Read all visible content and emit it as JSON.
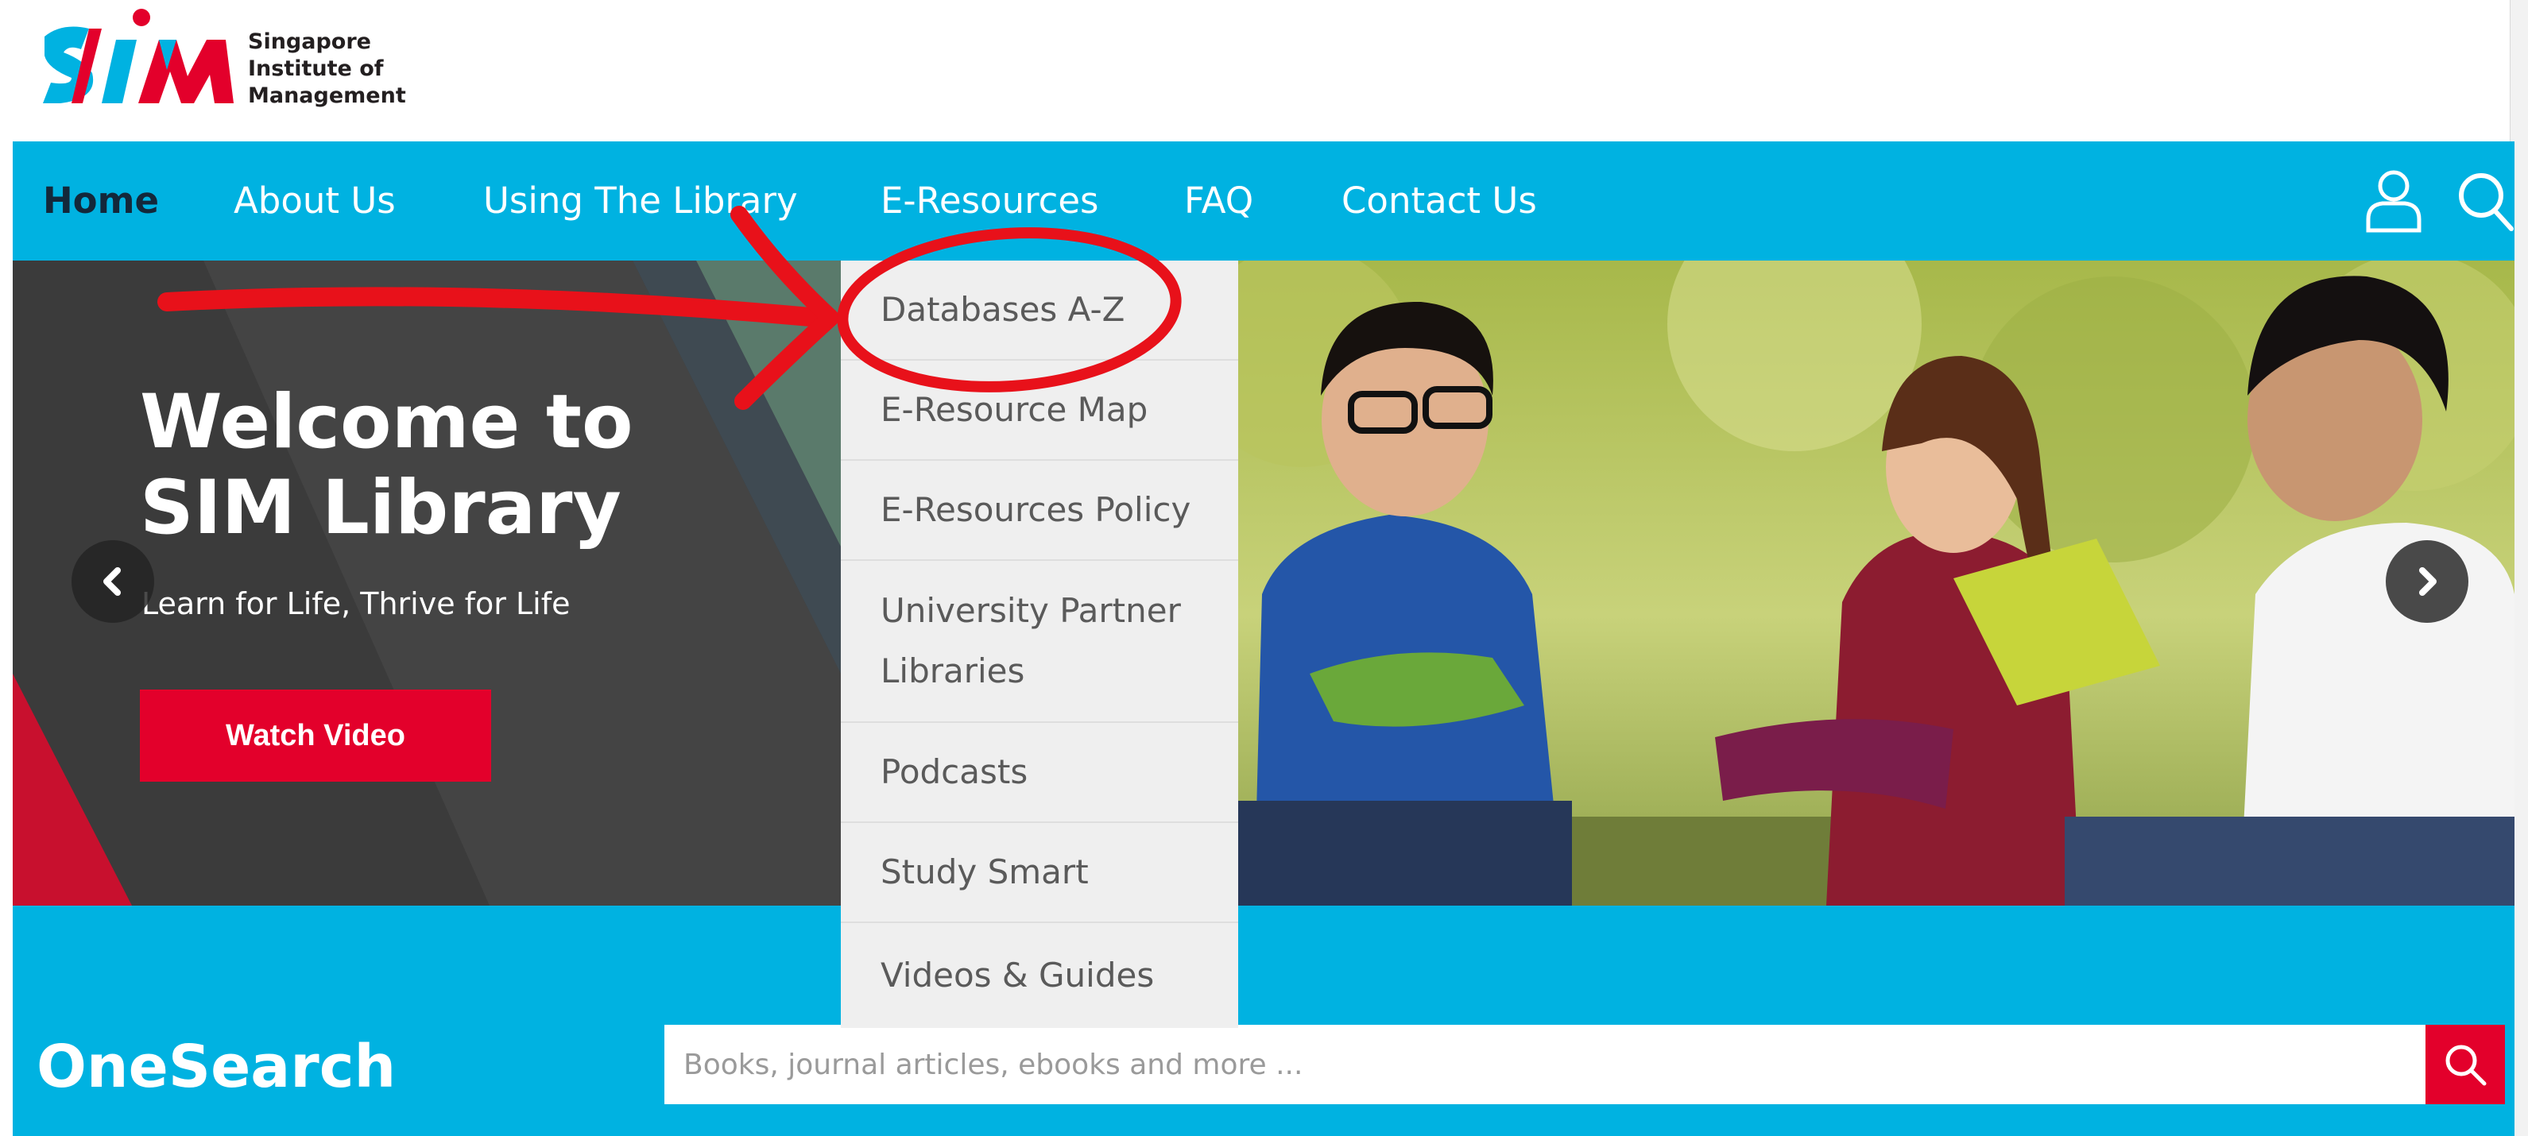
{
  "header": {
    "logo_text_line1": "Singapore",
    "logo_text_line2": "Institute of",
    "logo_text_line3": "Management",
    "logo_icon": "sim-logo"
  },
  "nav": {
    "items": [
      {
        "label": "Home",
        "active": true
      },
      {
        "label": "About Us"
      },
      {
        "label": "Using The Library"
      },
      {
        "label": "E-Resources"
      },
      {
        "label": "FAQ"
      },
      {
        "label": "Contact Us"
      }
    ],
    "icons": [
      "user-icon",
      "search-icon"
    ]
  },
  "hero": {
    "title_line1": "Welcome to",
    "title_line2": "SIM Library",
    "subtitle": "Learn for Life, Thrive for Life",
    "button_label": "Watch Video",
    "prev_icon": "chevron-left-icon",
    "next_icon": "chevron-right-icon"
  },
  "dropdown": {
    "parent": "E-Resources",
    "items": [
      "Databases A-Z",
      "E-Resource Map",
      "E-Resources Policy",
      "University Partner Libraries",
      "Podcasts",
      "Study Smart",
      "Videos & Guides"
    ]
  },
  "onesearch": {
    "title": "OneSearch",
    "placeholder": "Books, journal articles, ebooks and more ...",
    "button_icon": "search-icon"
  },
  "colors": {
    "brand_blue": "#00b2e1",
    "brand_red": "#e3002b",
    "nav_active": "#13283a",
    "annotation_red": "#e8111a"
  }
}
